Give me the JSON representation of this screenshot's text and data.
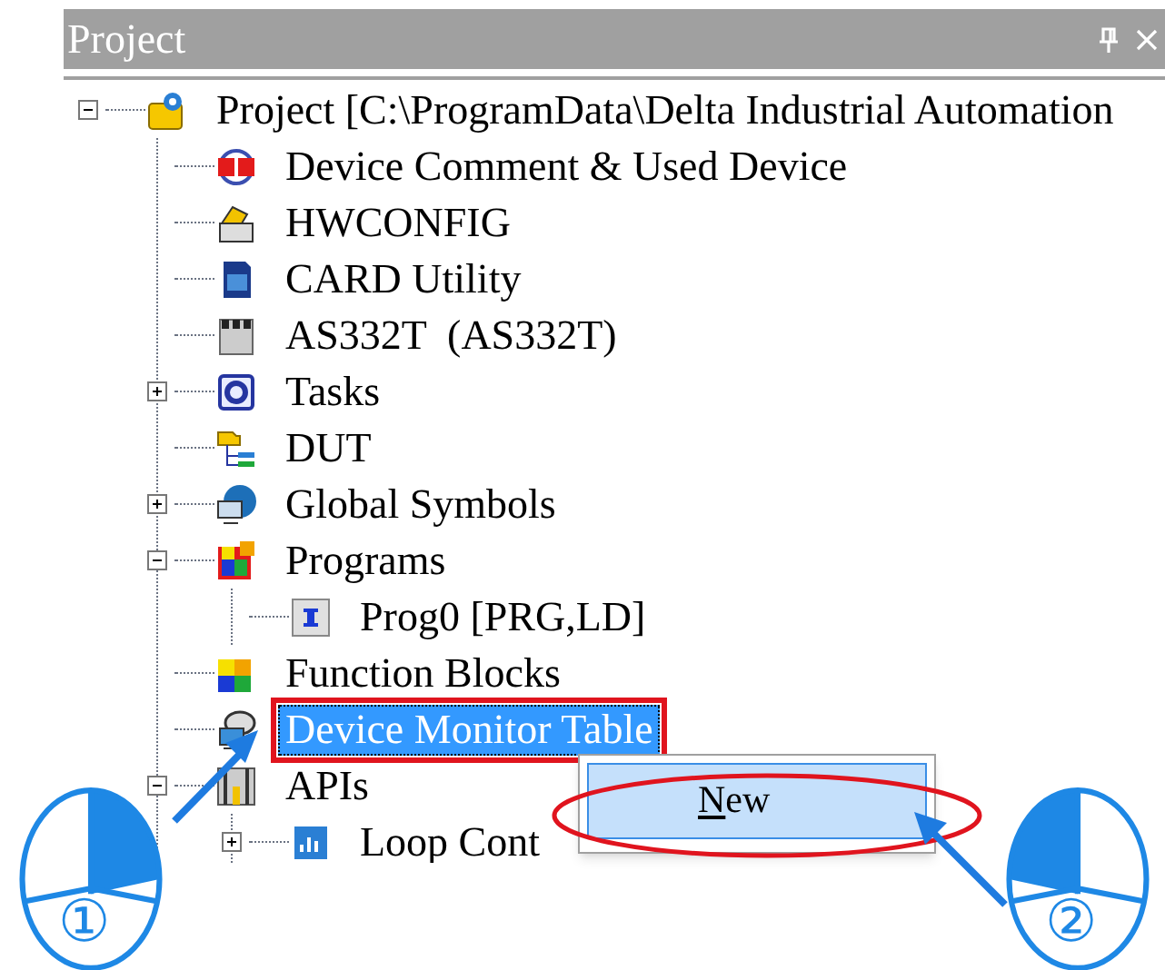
{
  "panel": {
    "title": "Project"
  },
  "tree": [
    {
      "label": "Project [C:\\ProgramData\\Delta Industrial Automation",
      "kind": "project",
      "expanded": true,
      "selected": false,
      "children": [
        {
          "label": "Device Comment & Used Device",
          "kind": "comment",
          "selected": false
        },
        {
          "label": "HWCONFIG",
          "kind": "hwconfig",
          "selected": false
        },
        {
          "label": "CARD Utility",
          "kind": "card",
          "selected": false
        },
        {
          "label": "AS332T  (AS332T)",
          "kind": "cpu",
          "selected": false
        },
        {
          "label": "Tasks",
          "kind": "tasks",
          "expanded": false,
          "selected": false
        },
        {
          "label": "DUT",
          "kind": "dut",
          "selected": false
        },
        {
          "label": "Global Symbols",
          "kind": "symbols",
          "expanded": false,
          "selected": false
        },
        {
          "label": "Programs",
          "kind": "programs",
          "expanded": true,
          "selected": false,
          "children": [
            {
              "label": "Prog0 [PRG,LD]",
              "kind": "pou",
              "selected": false
            }
          ]
        },
        {
          "label": "Function Blocks",
          "kind": "blocks",
          "selected": false
        },
        {
          "label": "Device Monitor Table",
          "kind": "monitor",
          "selected": true
        },
        {
          "label": "APIs",
          "kind": "apis",
          "expanded": true,
          "selected": false,
          "children": [
            {
              "label": "Loop Cont",
              "kind": "loop",
              "expanded": false,
              "selected": false
            }
          ]
        }
      ]
    }
  ],
  "context_menu": {
    "items": [
      {
        "label": "New",
        "selected": true
      }
    ]
  },
  "callouts": [
    {
      "label": "①",
      "kind": "left"
    },
    {
      "label": "②",
      "kind": "right"
    }
  ]
}
